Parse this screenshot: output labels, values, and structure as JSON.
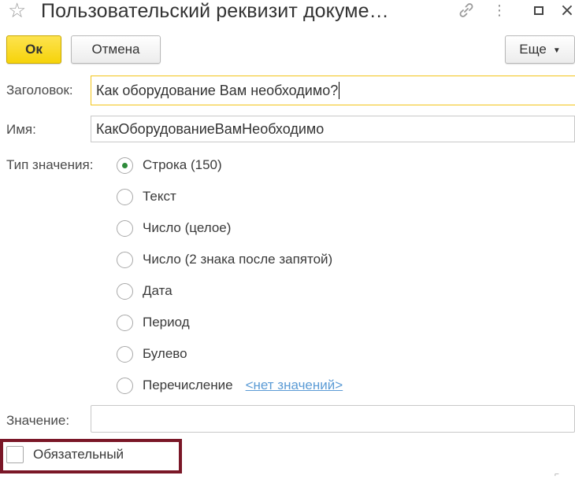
{
  "window": {
    "title": "Пользовательский реквизит докуме…"
  },
  "toolbar": {
    "ok_label": "Ок",
    "cancel_label": "Отмена",
    "more_label": "Еще"
  },
  "form": {
    "header_label": "Заголовок:",
    "header_value": "Как оборудование Вам необходимо?",
    "name_label": "Имя:",
    "name_value": "КакОборудованиеВамНеобходимо",
    "type_label": "Тип значения:",
    "types": [
      {
        "label": "Строка (150)",
        "checked": true
      },
      {
        "label": "Текст",
        "checked": false
      },
      {
        "label": "Число (целое)",
        "checked": false
      },
      {
        "label": "Число (2 знака после запятой)",
        "checked": false
      },
      {
        "label": "Дата",
        "checked": false
      },
      {
        "label": "Период",
        "checked": false
      },
      {
        "label": "Булево",
        "checked": false
      },
      {
        "label": "Перечисление",
        "checked": false
      }
    ],
    "enum_link": "<нет значений>",
    "value_label": "Значение:",
    "value": "",
    "required_label": "Обязательный",
    "required_checked": false
  },
  "colors": {
    "accent_yellow": "#f6d30a",
    "radio_checked": "#2e8b3a",
    "link": "#5b9bd5",
    "highlight_frame": "#7a1727"
  },
  "icons": {
    "favorite": "star-icon",
    "link": "link-icon",
    "more": "more-vertical-icon",
    "maximize": "maximize-icon",
    "close": "close-icon"
  }
}
